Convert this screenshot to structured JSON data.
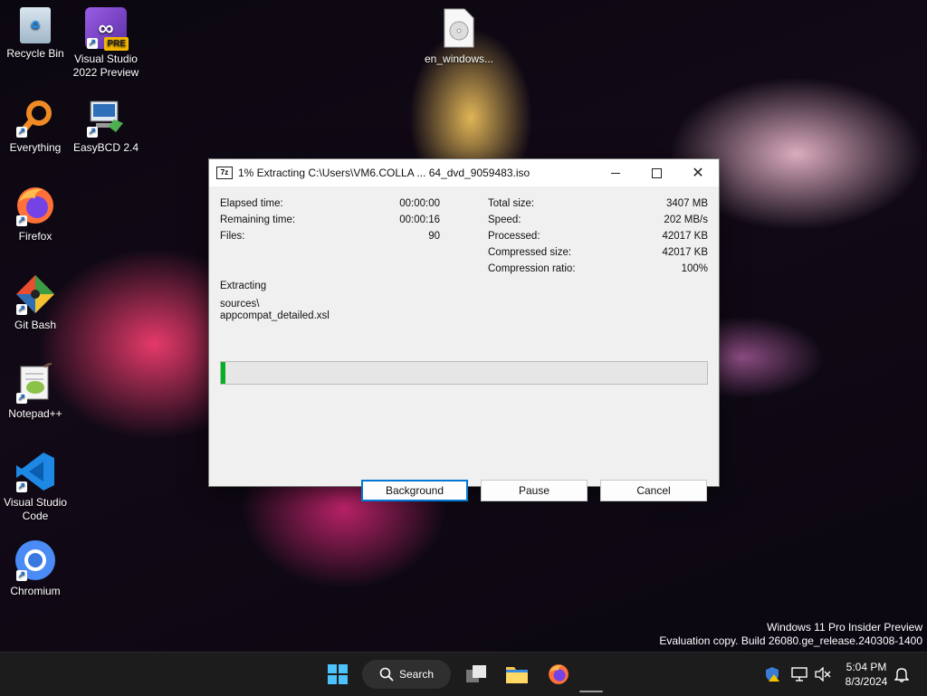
{
  "desktop": {
    "icons": [
      {
        "label": "Recycle Bin"
      },
      {
        "label": "Visual Studio 2022 Preview",
        "badge": "PRE"
      },
      {
        "label": "Everything"
      },
      {
        "label": "EasyBCD 2.4"
      },
      {
        "label": "Firefox"
      },
      {
        "label": "Git Bash"
      },
      {
        "label": "Notepad++"
      },
      {
        "label": "Visual Studio Code"
      },
      {
        "label": "Chromium"
      },
      {
        "label": "en_windows..."
      }
    ],
    "watermark": {
      "line1": "Windows 11 Pro Insider Preview",
      "line2": "Evaluation copy. Build 26080.ge_release.240308-1400"
    }
  },
  "dialog": {
    "title": "1% Extracting C:\\Users\\VM6.COLLA ... 64_dvd_9059483.iso",
    "app_icon_text": "7z",
    "stats_left": [
      {
        "label": "Elapsed time:",
        "value": "00:00:00"
      },
      {
        "label": "Remaining time:",
        "value": "00:00:16"
      },
      {
        "label": "Files:",
        "value": "90"
      }
    ],
    "stats_right": [
      {
        "label": "Total size:",
        "value": "3407 MB"
      },
      {
        "label": "Speed:",
        "value": "202 MB/s"
      },
      {
        "label": "Processed:",
        "value": "42017 KB"
      },
      {
        "label": "Compressed size:",
        "value": "42017 KB"
      },
      {
        "label": "Compression ratio:",
        "value": "100%"
      }
    ],
    "operation": "Extracting",
    "current_path": "sources\\",
    "current_file": "appcompat_detailed.xsl",
    "progress_percent": 1,
    "buttons": {
      "background": "Background",
      "pause": "Pause",
      "cancel": "Cancel"
    }
  },
  "taskbar": {
    "search_label": "Search",
    "time": "5:04 PM",
    "date": "8/3/2024"
  },
  "colors": {
    "accent": "#0078d4",
    "progress": "#06b025"
  }
}
